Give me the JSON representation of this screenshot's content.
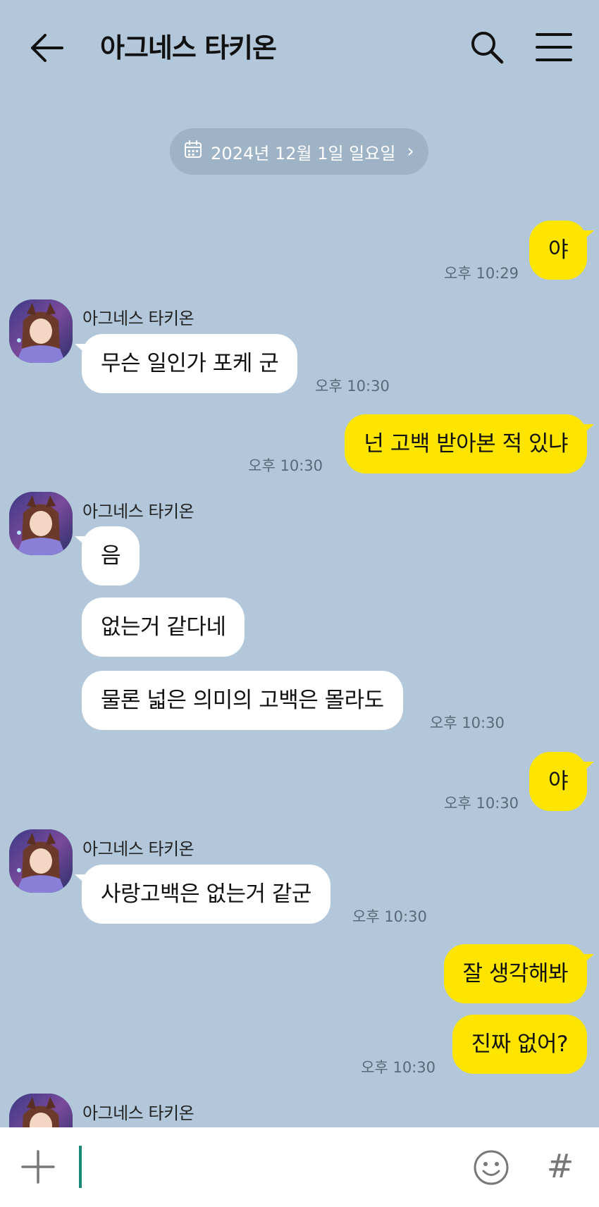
{
  "header": {
    "title": "아그네스 타키온",
    "back_icon": "back-arrow-icon",
    "search_icon": "search-icon",
    "menu_icon": "menu-icon"
  },
  "date_chip": {
    "icon": "calendar-icon",
    "label": "2024년 12월 1일 일요일",
    "chevron": "›"
  },
  "colors": {
    "background": "#b2c7da",
    "outgoing_bubble": "#fee500",
    "incoming_bubble": "#ffffff",
    "date_chip": "#9fb3c6",
    "caret": "#1a8a78"
  },
  "messages": [
    {
      "direction": "out",
      "text": "야",
      "time": "오후 10:29"
    },
    {
      "direction": "in",
      "sender": "아그네스 타키온",
      "text": "무슨 일인가 포케 군",
      "time": "오후 10:30"
    },
    {
      "direction": "out",
      "text": "넌 고백 받아본 적 있냐",
      "time": "오후 10:30"
    },
    {
      "direction": "in",
      "sender": "아그네스 타키온",
      "text": "음"
    },
    {
      "direction": "in",
      "text": "없는거 같다네"
    },
    {
      "direction": "in",
      "text": "물론 넓은 의미의 고백은 몰라도",
      "time": "오후 10:30"
    },
    {
      "direction": "out",
      "text": "야",
      "time": "오후 10:30"
    },
    {
      "direction": "in",
      "sender": "아그네스 타키온",
      "text": "사랑고백은 없는거 같군",
      "time": "오후 10:30"
    },
    {
      "direction": "out",
      "text": "잘 생각해봐"
    },
    {
      "direction": "out",
      "text": "진짜 없어?",
      "time": "오후 10:30"
    },
    {
      "direction": "in",
      "sender": "아그네스 타키온"
    }
  ],
  "composer": {
    "value": "",
    "plus_icon": "plus-icon",
    "emoji_icon": "emoji-icon",
    "hash_label": "#"
  }
}
